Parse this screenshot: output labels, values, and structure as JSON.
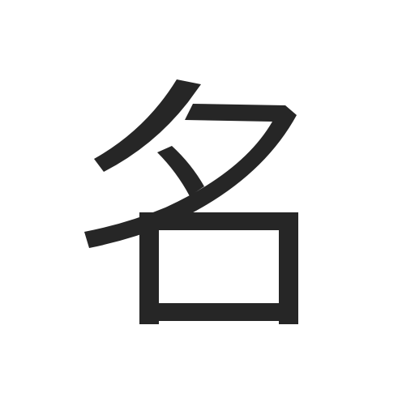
{
  "glyph": {
    "character": "名",
    "color": "#262626"
  },
  "background": "#ffffff"
}
